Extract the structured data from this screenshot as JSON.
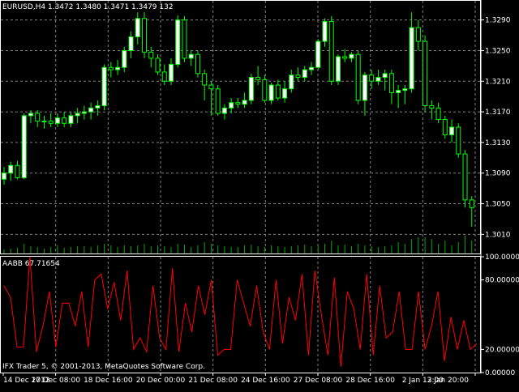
{
  "chart_data": [
    {
      "type": "candlestick",
      "title": "EURUSD,H4  1.3472 1.3480 1.3471 1.3479  132",
      "symbol": "EURUSD",
      "timeframe": "H4",
      "last_bar": {
        "open": 1.3472,
        "high": 1.348,
        "low": 1.3471,
        "close": 1.3479,
        "volume": 132
      },
      "ylim": [
        1.2985,
        1.3315
      ],
      "y_ticks": [
        "1.3290",
        "1.3250",
        "1.3210",
        "1.3170",
        "1.3130",
        "1.3090",
        "1.3050",
        "1.3010"
      ],
      "grid": true,
      "candles": [
        {
          "o": 1.3082,
          "h": 1.3098,
          "l": 1.3075,
          "c": 1.309
        },
        {
          "o": 1.309,
          "h": 1.3105,
          "l": 1.308,
          "c": 1.31
        },
        {
          "o": 1.31,
          "h": 1.3106,
          "l": 1.3082,
          "c": 1.3084
        },
        {
          "o": 1.3084,
          "h": 1.3168,
          "l": 1.3082,
          "c": 1.3165
        },
        {
          "o": 1.3165,
          "h": 1.3172,
          "l": 1.3155,
          "c": 1.3168
        },
        {
          "o": 1.3168,
          "h": 1.3172,
          "l": 1.315,
          "c": 1.3158
        },
        {
          "o": 1.3158,
          "h": 1.3165,
          "l": 1.3148,
          "c": 1.3158
        },
        {
          "o": 1.3158,
          "h": 1.3168,
          "l": 1.315,
          "c": 1.3155
        },
        {
          "o": 1.3155,
          "h": 1.3168,
          "l": 1.315,
          "c": 1.3162
        },
        {
          "o": 1.3162,
          "h": 1.317,
          "l": 1.315,
          "c": 1.3155
        },
        {
          "o": 1.3155,
          "h": 1.317,
          "l": 1.315,
          "c": 1.3165
        },
        {
          "o": 1.3165,
          "h": 1.3175,
          "l": 1.3155,
          "c": 1.3168
        },
        {
          "o": 1.3168,
          "h": 1.3178,
          "l": 1.316,
          "c": 1.317
        },
        {
          "o": 1.317,
          "h": 1.3182,
          "l": 1.316,
          "c": 1.3175
        },
        {
          "o": 1.3175,
          "h": 1.3185,
          "l": 1.3165,
          "c": 1.3178
        },
        {
          "o": 1.3178,
          "h": 1.3232,
          "l": 1.3172,
          "c": 1.3228
        },
        {
          "o": 1.3228,
          "h": 1.3235,
          "l": 1.3215,
          "c": 1.3225
        },
        {
          "o": 1.3225,
          "h": 1.3238,
          "l": 1.3218,
          "c": 1.3228
        },
        {
          "o": 1.3228,
          "h": 1.3255,
          "l": 1.3222,
          "c": 1.325
        },
        {
          "o": 1.325,
          "h": 1.3275,
          "l": 1.324,
          "c": 1.3268
        },
        {
          "o": 1.3268,
          "h": 1.33,
          "l": 1.3258,
          "c": 1.3292
        },
        {
          "o": 1.3292,
          "h": 1.33,
          "l": 1.324,
          "c": 1.3248
        },
        {
          "o": 1.3248,
          "h": 1.3255,
          "l": 1.3228,
          "c": 1.324
        },
        {
          "o": 1.324,
          "h": 1.3245,
          "l": 1.3218,
          "c": 1.3222
        },
        {
          "o": 1.3222,
          "h": 1.3232,
          "l": 1.3205,
          "c": 1.321
        },
        {
          "o": 1.321,
          "h": 1.324,
          "l": 1.3205,
          "c": 1.3232
        },
        {
          "o": 1.3232,
          "h": 1.3296,
          "l": 1.3228,
          "c": 1.329
        },
        {
          "o": 1.329,
          "h": 1.3295,
          "l": 1.3235,
          "c": 1.324
        },
        {
          "o": 1.324,
          "h": 1.325,
          "l": 1.323,
          "c": 1.3245
        },
        {
          "o": 1.3245,
          "h": 1.325,
          "l": 1.3215,
          "c": 1.322
        },
        {
          "o": 1.322,
          "h": 1.3225,
          "l": 1.3185,
          "c": 1.3205
        },
        {
          "o": 1.3205,
          "h": 1.321,
          "l": 1.3165,
          "c": 1.32
        },
        {
          "o": 1.32,
          "h": 1.3205,
          "l": 1.3165,
          "c": 1.3168
        },
        {
          "o": 1.3168,
          "h": 1.318,
          "l": 1.316,
          "c": 1.3175
        },
        {
          "o": 1.3175,
          "h": 1.3188,
          "l": 1.3168,
          "c": 1.3182
        },
        {
          "o": 1.3182,
          "h": 1.3188,
          "l": 1.3175,
          "c": 1.318
        },
        {
          "o": 1.318,
          "h": 1.3195,
          "l": 1.3175,
          "c": 1.3185
        },
        {
          "o": 1.3185,
          "h": 1.322,
          "l": 1.318,
          "c": 1.3215
        },
        {
          "o": 1.3215,
          "h": 1.323,
          "l": 1.3205,
          "c": 1.3212
        },
        {
          "o": 1.3212,
          "h": 1.3218,
          "l": 1.3182,
          "c": 1.3185
        },
        {
          "o": 1.3185,
          "h": 1.3208,
          "l": 1.318,
          "c": 1.3205
        },
        {
          "o": 1.3205,
          "h": 1.3212,
          "l": 1.3185,
          "c": 1.3188
        },
        {
          "o": 1.3188,
          "h": 1.321,
          "l": 1.3182,
          "c": 1.32
        },
        {
          "o": 1.32,
          "h": 1.3225,
          "l": 1.3195,
          "c": 1.3218
        },
        {
          "o": 1.3218,
          "h": 1.3228,
          "l": 1.321,
          "c": 1.3215
        },
        {
          "o": 1.3215,
          "h": 1.323,
          "l": 1.321,
          "c": 1.3225
        },
        {
          "o": 1.3225,
          "h": 1.3235,
          "l": 1.3218,
          "c": 1.3228
        },
        {
          "o": 1.3228,
          "h": 1.3265,
          "l": 1.3225,
          "c": 1.3262
        },
        {
          "o": 1.3262,
          "h": 1.3292,
          "l": 1.3255,
          "c": 1.3288
        },
        {
          "o": 1.3288,
          "h": 1.3295,
          "l": 1.3205,
          "c": 1.321
        },
        {
          "o": 1.321,
          "h": 1.3245,
          "l": 1.3205,
          "c": 1.3242
        },
        {
          "o": 1.3242,
          "h": 1.3252,
          "l": 1.3235,
          "c": 1.324
        },
        {
          "o": 1.324,
          "h": 1.3248,
          "l": 1.3235,
          "c": 1.3245
        },
        {
          "o": 1.3245,
          "h": 1.325,
          "l": 1.318,
          "c": 1.3185
        },
        {
          "o": 1.3185,
          "h": 1.3222,
          "l": 1.3165,
          "c": 1.3218
        },
        {
          "o": 1.3218,
          "h": 1.3225,
          "l": 1.32,
          "c": 1.321
        },
        {
          "o": 1.321,
          "h": 1.3225,
          "l": 1.3205,
          "c": 1.3215
        },
        {
          "o": 1.3215,
          "h": 1.3225,
          "l": 1.3198,
          "c": 1.322
        },
        {
          "o": 1.322,
          "h": 1.3225,
          "l": 1.318,
          "c": 1.3195
        },
        {
          "o": 1.3195,
          "h": 1.3205,
          "l": 1.3175,
          "c": 1.3198
        },
        {
          "o": 1.3198,
          "h": 1.3205,
          "l": 1.318,
          "c": 1.32
        },
        {
          "o": 1.32,
          "h": 1.33,
          "l": 1.3195,
          "c": 1.328
        },
        {
          "o": 1.328,
          "h": 1.329,
          "l": 1.325,
          "c": 1.3262
        },
        {
          "o": 1.3262,
          "h": 1.327,
          "l": 1.317,
          "c": 1.3178
        },
        {
          "o": 1.3178,
          "h": 1.3185,
          "l": 1.316,
          "c": 1.3175
        },
        {
          "o": 1.3175,
          "h": 1.3182,
          "l": 1.3155,
          "c": 1.316
        },
        {
          "o": 1.316,
          "h": 1.3165,
          "l": 1.3135,
          "c": 1.314
        },
        {
          "o": 1.314,
          "h": 1.316,
          "l": 1.313,
          "c": 1.315
        },
        {
          "o": 1.315,
          "h": 1.3155,
          "l": 1.311,
          "c": 1.3115
        },
        {
          "o": 1.3115,
          "h": 1.312,
          "l": 1.3045,
          "c": 1.3055
        },
        {
          "o": 1.3055,
          "h": 1.306,
          "l": 1.302,
          "c": 1.3045
        }
      ],
      "volumes": [
        5,
        6,
        7,
        12,
        9,
        8,
        6,
        8,
        10,
        7,
        8,
        9,
        9,
        8,
        10,
        12,
        10,
        8,
        10,
        9,
        10,
        12,
        9,
        10,
        9,
        8,
        12,
        11,
        8,
        10,
        14,
        12,
        10,
        9,
        8,
        8,
        10,
        11,
        9,
        8,
        10,
        9,
        8,
        9,
        10,
        11,
        9,
        10,
        12,
        16,
        10,
        11,
        9,
        12,
        10,
        9,
        8,
        9,
        10,
        14,
        12,
        18,
        20,
        20,
        18,
        12,
        16,
        10,
        14,
        22,
        16
      ]
    },
    {
      "type": "line",
      "title": "AABB 67.71654",
      "indicator": "AABB",
      "value": 67.71654,
      "ylim": [
        0,
        100
      ],
      "y_ticks": [
        "100.00000",
        "80.00000",
        "20.00000",
        "0.00000"
      ],
      "series": [
        {
          "color": "#ff0000",
          "values": [
            75,
            65,
            22,
            22,
            100,
            18,
            40,
            70,
            22,
            60,
            60,
            40,
            70,
            22,
            80,
            85,
            55,
            78,
            45,
            88,
            20,
            30,
            18,
            75,
            30,
            20,
            90,
            18,
            60,
            35,
            75,
            50,
            80,
            15,
            20,
            20,
            80,
            60,
            40,
            75,
            35,
            20,
            80,
            25,
            65,
            45,
            85,
            15,
            88,
            50,
            15,
            82,
            5,
            70,
            55,
            20,
            85,
            15,
            75,
            30,
            35,
            70,
            20,
            20,
            70,
            20,
            40,
            70,
            10,
            48,
            20,
            45,
            20,
            25
          ]
        }
      ]
    }
  ],
  "x_axis": {
    "labels": [
      "14 Dec 2012",
      "17 Dec 08:00",
      "18 Dec 16:00",
      "20 Dec 00:00",
      "21 Dec 08:00",
      "24 Dec 16:00",
      "27 Dec 08:00",
      "28 Dec 16:00",
      "2 Jan 12:00",
      "3 Jan 20:00"
    ]
  },
  "copyright": "IFX Trader 5, © 2001-2013, MetaQuotes Software Corp.",
  "colors": {
    "background": "#000000",
    "grid": "#7f7f7f",
    "bull_body": "#ffffff",
    "bar": "#00ff00",
    "volume": "#00aa00",
    "indicator_line": "#ff0000",
    "text": "#ffffff"
  }
}
